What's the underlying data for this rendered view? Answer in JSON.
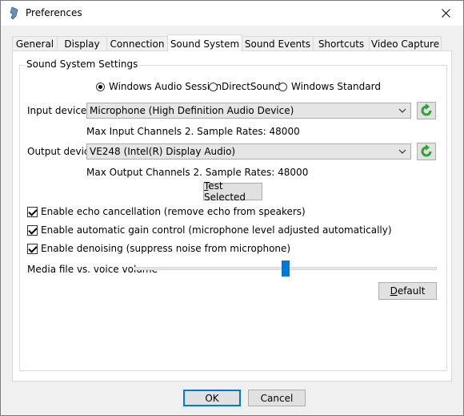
{
  "window": {
    "title": "Preferences"
  },
  "tabs": [
    {
      "label": "General"
    },
    {
      "label": "Display"
    },
    {
      "label": "Connection"
    },
    {
      "label": "Sound System",
      "active": true
    },
    {
      "label": "Sound Events"
    },
    {
      "label": "Shortcuts"
    },
    {
      "label": "Video Capture"
    }
  ],
  "sound_system": {
    "group_title": "Sound System Settings",
    "radios": [
      {
        "label": "Windows Audio Session",
        "selected": true
      },
      {
        "label": "DirectSound",
        "selected": false
      },
      {
        "label": "Windows Standard",
        "selected": false
      }
    ],
    "input": {
      "label": "Input device",
      "value": "Microphone (High Definition Audio Device)",
      "info": "Max Input Channels 2. Sample Rates: 48000"
    },
    "output": {
      "label": "Output device",
      "value": "VE248 (Intel(R) Display Audio)",
      "info": "Max Output Channels 2. Sample Rates: 48000"
    },
    "test_button": {
      "accel": "T",
      "rest": "est Selected"
    },
    "checks": [
      {
        "label": "Enable echo cancellation (remove echo from speakers)",
        "checked": true
      },
      {
        "label": "Enable automatic gain control (microphone level adjusted automatically)",
        "checked": true
      },
      {
        "label": "Enable denoising (suppress noise from microphone)",
        "checked": true
      }
    ],
    "volume": {
      "label": "Media file vs. voice volume",
      "level_fraction": 0.5
    },
    "default_button": {
      "accel": "D",
      "rest": "efault"
    }
  },
  "footer": {
    "ok": "OK",
    "cancel": "Cancel"
  },
  "colors": {
    "accent": "#0078d7",
    "refresh_icon": "#2ea32e"
  }
}
